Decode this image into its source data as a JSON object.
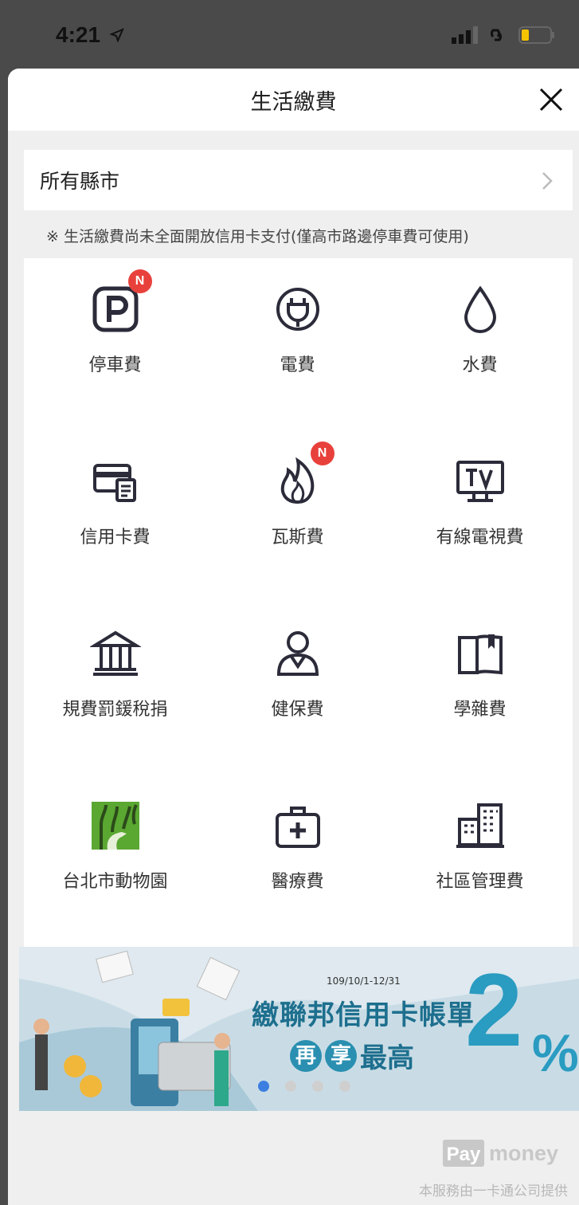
{
  "status_bar": {
    "time": "4:21"
  },
  "header": {
    "title": "生活繳費",
    "close_icon": "close-icon"
  },
  "city_selector": {
    "label": "所有縣市"
  },
  "notice": "※ 生活繳費尚未全面開放信用卡支付(僅高市路邊停車費可使用)",
  "services": [
    {
      "label": "停車費",
      "icon": "parking-icon",
      "badge": "N"
    },
    {
      "label": "電費",
      "icon": "plug-icon",
      "badge": ""
    },
    {
      "label": "水費",
      "icon": "water-drop-icon",
      "badge": ""
    },
    {
      "label": "信用卡費",
      "icon": "credit-card-bill-icon",
      "badge": ""
    },
    {
      "label": "瓦斯費",
      "icon": "flame-icon",
      "badge": "N"
    },
    {
      "label": "有線電視費",
      "icon": "tv-icon",
      "badge": ""
    },
    {
      "label": "規費罰鍰稅捐",
      "icon": "government-building-icon",
      "badge": ""
    },
    {
      "label": "健保費",
      "icon": "person-icon",
      "badge": ""
    },
    {
      "label": "學雜費",
      "icon": "book-icon",
      "badge": ""
    },
    {
      "label": "台北市動物園",
      "icon": "zoo-logo-icon",
      "badge": ""
    },
    {
      "label": "醫療費",
      "icon": "medical-kit-icon",
      "badge": ""
    },
    {
      "label": "社區管理費",
      "icon": "building-icon",
      "badge": ""
    }
  ],
  "banner": {
    "date": "109/10/1-12/31",
    "line1": "繳聯邦信用卡帳單",
    "line2_c1": "再",
    "line2_c2": "享",
    "line2_rest": "最高",
    "big_number": "2",
    "percent": "%",
    "page_count": 4,
    "active_page": 1
  },
  "brand": {
    "pay": "Pay",
    "money": "money"
  },
  "footer": "本服務由一卡通公司提供",
  "colors": {
    "badge": "#e8413b",
    "accent": "#3c7fe0",
    "banner_text": "#1d6f8e",
    "zoo_green": "#5aa731"
  }
}
